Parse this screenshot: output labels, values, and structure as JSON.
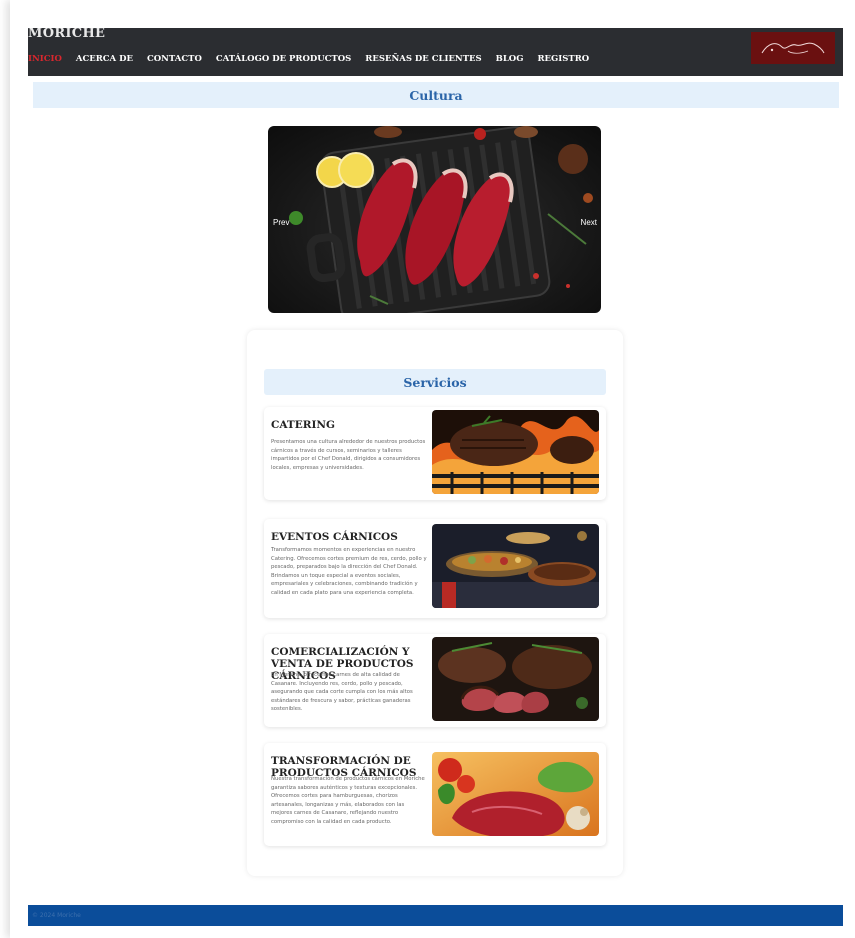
{
  "header": {
    "brand": "MORICHE",
    "nav": [
      "INICIO",
      "ACERCA DE",
      "CONTACTO",
      "CATÁLOGO DE PRODUCTOS",
      "RESEÑAS DE CLIENTES",
      "BLOG",
      "REGISTRO"
    ],
    "active_index": 0
  },
  "culture": {
    "heading": "Cultura",
    "prev_label": "Prev",
    "next_label": "Next"
  },
  "services": {
    "heading": "Servicios",
    "items": [
      {
        "title": "CATERING",
        "description": "Presentamos una cultura alrededor de nuestros productos cárnicos a través de cursos, seminarios y talleres impartidos por el Chef Donald, dirigidos a consumidores locales, empresas y universidades.",
        "image_icon": "grilled-steak-icon"
      },
      {
        "title": "EVENTOS CÁRNICOS",
        "description": "Transformamos momentos en experiencias en nuestro Catering. Ofrecemos cortes premium de res, cerdo, pollo y pescado, preparados bajo la dirección del Chef Donald. Brindamos un toque especial a eventos sociales, empresariales y celebraciones, combinando tradición y calidad en cada plato para una experiencia completa.",
        "image_icon": "buffet-icon"
      },
      {
        "title": "COMERCIALIZACIÓN Y VENTA DE PRODUCTOS CÁRNICOS",
        "description": "En Moriche, ofrecemos carnes de alta calidad de Casanare. Incluyendo res, cerdo, pollo y pescado, asegurando que cada corte cumpla con los más altos estándares de frescura y sabor, prácticas ganaderas sostenibles.",
        "image_icon": "sliced-steak-icon"
      },
      {
        "title": "TRANSFORMACIÓN DE PRODUCTOS CÁRNICOS",
        "description": "Nuestra transformación de productos cárnicos en Moriche garantiza sabores auténticos y texturas excepcionales. Ofrecemos cortes para hamburguesas, chorizos artesanales, longanizas y más, elaborados con las mejores carnes de Casanare, reflejando nuestro compromiso con la calidad en cada producto.",
        "image_icon": "raw-meat-icon"
      }
    ]
  },
  "footer": {
    "text": "© 2024 Moriche"
  },
  "colors": {
    "nav_bg": "#2b2d31",
    "nav_active": "#d9272e",
    "section_header_bg": "#e4f0fb",
    "section_header_text": "#2a64a8",
    "footer_bg": "#0b4d9a",
    "logo_bg": "#6a1010"
  }
}
